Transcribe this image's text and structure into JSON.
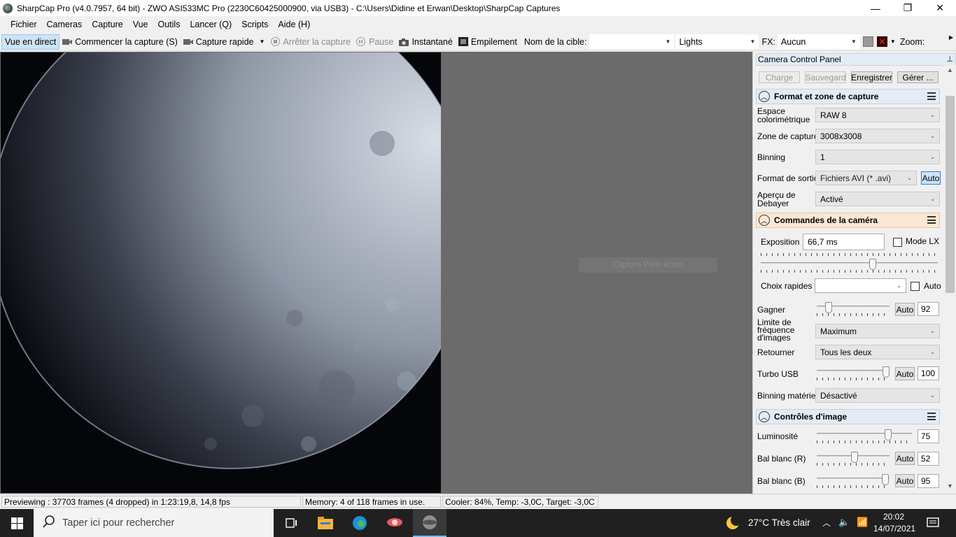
{
  "window": {
    "title": "SharpCap Pro (v4.0.7957, 64 bit) - ZWO ASI533MC Pro (2230C60425000900, via USB3) - C:\\Users\\Didine et Erwan\\Desktop\\SharpCap Captures",
    "minimize": "—",
    "maximize": "❐",
    "close": "✕"
  },
  "menu": [
    "Fichier",
    "Cameras",
    "Capture",
    "Vue",
    "Outils",
    "Lancer (Q)",
    "Scripts",
    "Aide (H)"
  ],
  "toolbar": {
    "live_view": "Vue en direct",
    "start_capture": "Commencer la capture (S)",
    "quick_capture": "Capture rapide",
    "stop_capture": "Arrêter la capture",
    "pause": "Pause",
    "snapshot": "Instantané",
    "stacking": "Empilement",
    "target_label": "Nom de la cible:",
    "target_value": "",
    "frame_type": "Lights",
    "fx_label": "FX:",
    "fx_value": "Aucun",
    "zoom_label": "Zoom:"
  },
  "viewer": {
    "fullscreen_label": "Capture Plein écran"
  },
  "panel": {
    "title": "Camera Control Panel",
    "pin": "📌",
    "buttons": {
      "load": "Charge",
      "save": "Sauvegard",
      "save_as": "Enregistrer",
      "manage": "Gérer ..."
    },
    "format_section": {
      "title": "Format et zone de capture",
      "color_space_label": "Espace colorimétrique",
      "color_space_value": "RAW 8",
      "capture_area_label": "Zone de capture",
      "capture_area_value": "3008x3008",
      "binning_label": "Binning",
      "binning_value": "1",
      "output_format_label": "Format de sortie",
      "output_format_value": "Fichiers AVI (* .avi)",
      "output_auto": "Auto",
      "debayer_label": "Aperçu de Debayer",
      "debayer_value": "Activé"
    },
    "camera_section": {
      "title": "Commandes de la caméra",
      "exposure_label": "Exposition",
      "exposure_value": "66,7 ms",
      "lx_mode_label": "Mode LX",
      "quick_choices_label": "Choix rapides",
      "quick_auto": "Auto",
      "gain_label": "Gagner",
      "gain_auto": "Auto",
      "gain_value": "92",
      "framerate_label": "Limite de fréquence d'images",
      "framerate_value": "Maximum",
      "flip_label": "Retourner",
      "flip_value": "Tous les deux",
      "turbo_label": "Turbo USB",
      "turbo_auto": "Auto",
      "turbo_value": "100",
      "hw_binning_label": "Binning matériel",
      "hw_binning_value": "Désactivé"
    },
    "image_section": {
      "title": "Contrôles d'image",
      "brightness_label": "Luminosité",
      "brightness_value": "75",
      "wb_r_label": "Bal blanc (R)",
      "wb_r_auto": "Auto",
      "wb_r_value": "52",
      "wb_b_label": "Bal blanc (B)",
      "wb_b_auto": "Auto",
      "wb_b_value": "95"
    }
  },
  "status": {
    "preview": "Previewing : 37703 frames (4 dropped) in 1:23:19,8, 14,8 fps",
    "memory": "Memory: 4 of 118 frames in use.",
    "cooler": "Cooler: 84%, Temp: -3,0C, Target: -3,0C"
  },
  "taskbar": {
    "search_placeholder": "Taper ici pour rechercher",
    "weather": "27°C  Très clair",
    "time": "20:02",
    "date": "14/07/2021"
  },
  "colors": {
    "accent": "#cce4f7",
    "taskbar": "#202020",
    "section_orange": "#fbe7d2",
    "section_blue": "#e3ecf6"
  }
}
